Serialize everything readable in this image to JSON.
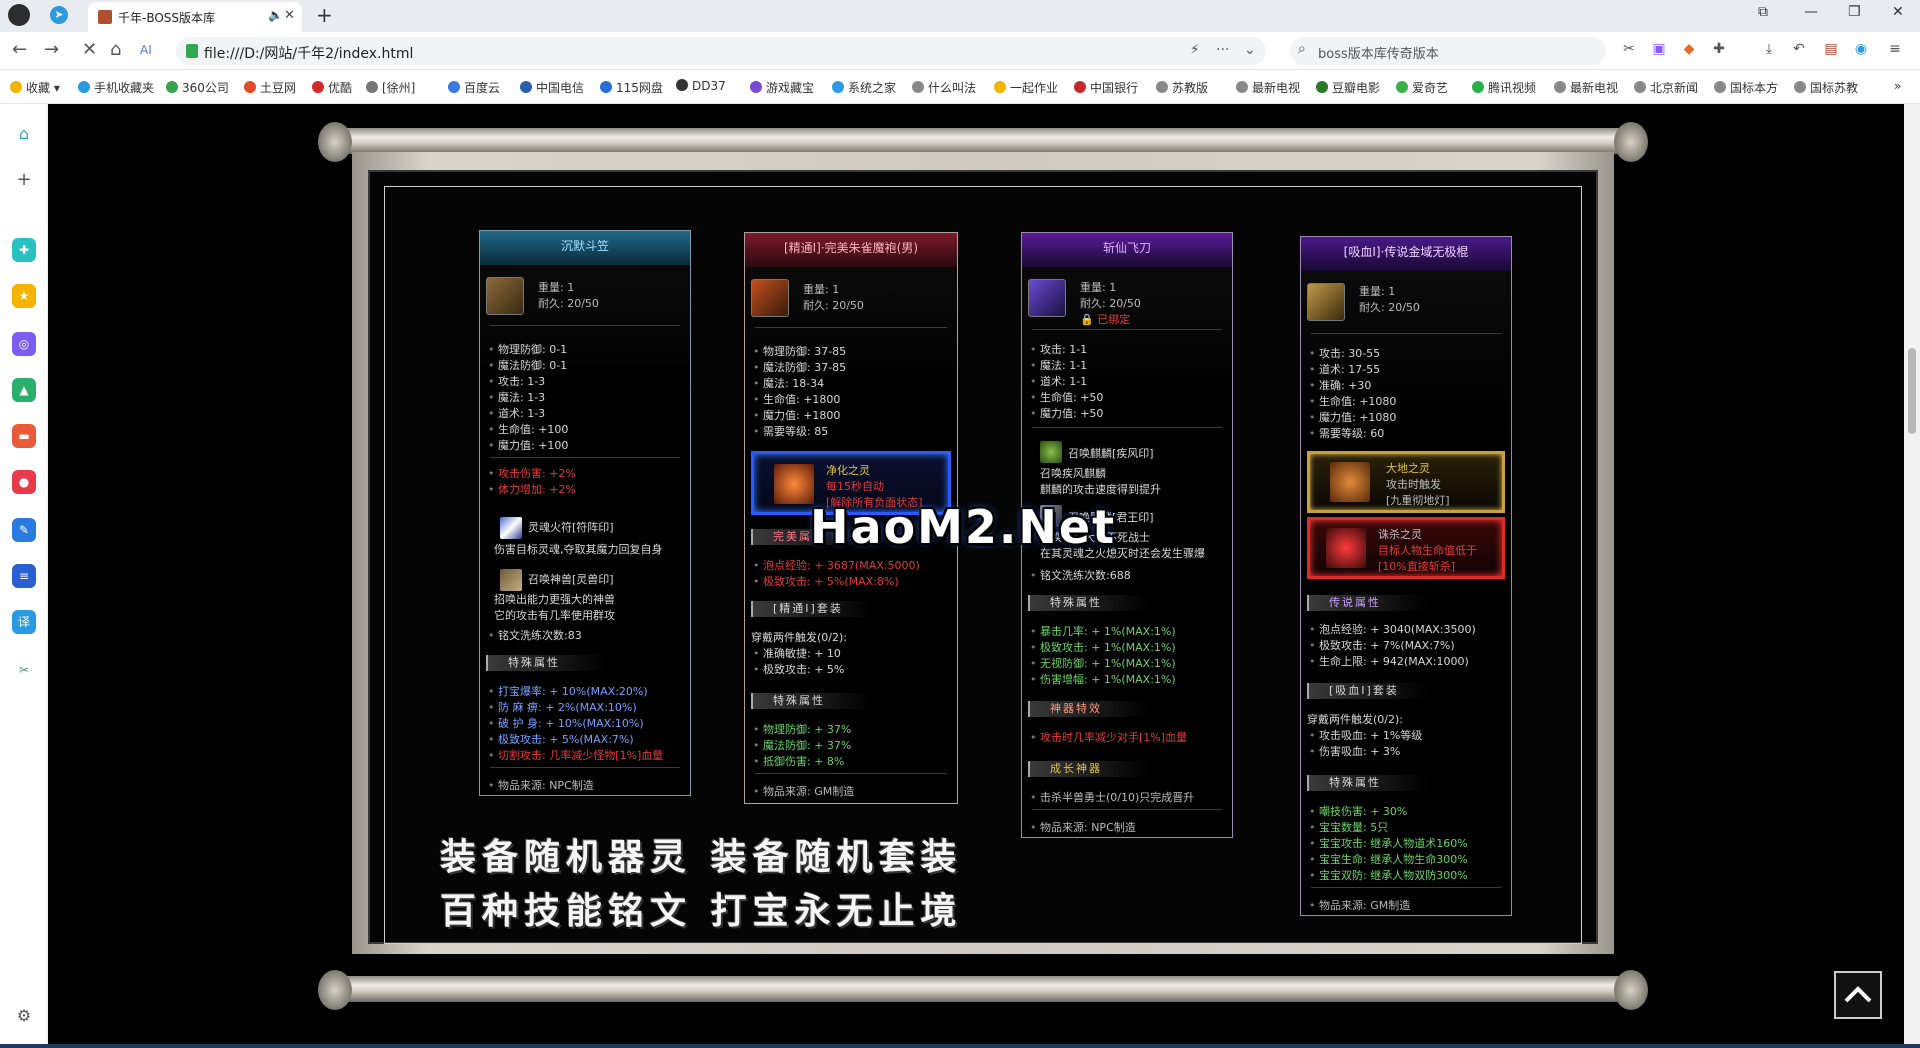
{
  "browser": {
    "tab_title": "千年-BOSS版本库",
    "new_tab": "+",
    "url": "file:///D:/网站/千年2/index.html",
    "search_text": "boss版本库传奇版本",
    "bookmarks": [
      "收藏",
      "手机收藏夹",
      "360公司",
      "土豆网",
      "优酷",
      "[徐州]",
      "百度云",
      "中国电信",
      "115网盘",
      "DD37",
      "游戏藏宝",
      "系统之家",
      "什么叫法",
      "一起作业",
      "中国银行",
      "苏教版",
      "最新电视",
      "豆瓣电影",
      "爱奇艺",
      "腾讯视频",
      "最新电视",
      "北京新闻",
      "国标本方",
      "国标苏教"
    ]
  },
  "cards": [
    {
      "title": "沉默斗笠",
      "weight": "重量: 1",
      "durability": "耐久: 20/50",
      "stats": [
        "物理防御: 0-1",
        "魔法防御: 0-1",
        "攻击: 1-3",
        "魔法: 1-3",
        "道术: 1-3",
        "生命值: +100",
        "魔力值: +100"
      ],
      "red_stats": [
        "攻击伤害: +2%",
        "体力增加: +2%"
      ],
      "skill1_name": "灵魂火符[符阵印]",
      "skill1_desc": "伤害目标灵魂,夺取其魔力回复自身",
      "skill2_name": "召唤神兽[灵兽印]",
      "skill2_desc1": "招唤出能力更强大的神兽",
      "skill2_desc2": "它的攻击有几率使用群攻",
      "refine": "铭文洗练次数:83",
      "section": "特殊属性",
      "special": [
        "打宝爆率: + 10%(MAX:20%)",
        "防 麻 痹: + 2%(MAX:10%)",
        "破 护 身: + 10%(MAX:10%)",
        "极致攻击: + 5%(MAX:7%)"
      ],
      "special_red": "切割攻击: 几率减少怪物[1%]血量",
      "source": "物品来源: NPC制造"
    },
    {
      "title": "[精通Ⅰ]·完美朱雀魔袍(男)",
      "weight": "重量: 1",
      "durability": "耐久: 20/50",
      "stats": [
        "物理防御: 37-85",
        "魔法防御: 37-85",
        "魔法: 18-34",
        "生命值: +1800",
        "魔力值: +1800",
        "需要等级: 85"
      ],
      "spirit_name": "净化之灵",
      "spirit_line1": "每15秒自动",
      "spirit_line2": "[解除所有负面状态]",
      "perfect_label": "完美属性",
      "perfect_stats": [
        "泡点经验: + 3687(MAX:5000)",
        "极致攻击: + 5%(MAX:8%)"
      ],
      "set_label": "[精通Ⅰ]套装",
      "set_trigger": "穿戴两件触发(0/2):",
      "set_stats": [
        "准确敏捷: + 10",
        "极致攻击: + 5%"
      ],
      "section": "特殊属性",
      "special": [
        "物理防御: + 37%",
        "魔法防御: + 37%",
        "抵御伤害: + 8%"
      ],
      "source": "物品来源: GM制造"
    },
    {
      "title": "斩仙飞刀",
      "weight": "重量: 1",
      "durability": "耐久: 20/50",
      "bound": "已绑定",
      "stats": [
        "攻击: 1-1",
        "魔法: 1-1",
        "道术: 1-1",
        "生命值: +50",
        "魔力值: +50"
      ],
      "skill1_name": "召唤麒麟[疾风印]",
      "skill1_desc1": "召唤疾风麒麟",
      "skill1_desc2": "麒麟的攻击速度得到提升",
      "skill2_name": "召唤骷髅[君王印]",
      "skill2_desc1": "召唤出强大的不死战士",
      "skill2_desc2": "在其灵魂之火熄灭时还会发生骤爆",
      "refine": "铭文洗练次数:688",
      "section": "特殊属性",
      "special": [
        "暴击几率: + 1%(MAX:1%)",
        "极致攻击: + 1%(MAX:1%)",
        "无视防御: + 1%(MAX:1%)",
        "伤害增幅: + 1%(MAX:1%)"
      ],
      "godeffect_label": "神器特效",
      "godeffect": "攻击时几率减少对手[1%]血量",
      "grow_label": "成长神器",
      "grow": "击杀半兽勇士(0/10)只完成晋升",
      "source": "物品来源: NPC制造"
    },
    {
      "title": "[吸血Ⅰ]·传说金域无极棍",
      "weight": "重量: 1",
      "durability": "耐久: 20/50",
      "stats": [
        "攻击: 30-55",
        "道术: 17-55",
        "准确: +30",
        "生命值: +1080",
        "魔力值: +1080",
        "需要等级: 60"
      ],
      "earth_name": "大地之灵",
      "earth_line1": "攻击时触发",
      "earth_line2": "[九重彻地灯]",
      "kill_name": "诛杀之灵",
      "kill_line1": "目标人物生命值低于",
      "kill_line2": "[10%直接斩杀]",
      "legend_label": "传说属性",
      "legend_stats": [
        "泡点经验: + 3040(MAX:3500)",
        "极致攻击: + 7%(MAX:7%)",
        "生命上限: + 942(MAX:1000)"
      ],
      "set_label": "[吸血Ⅰ]套装",
      "set_trigger": "穿戴两件触发(0/2):",
      "set_stats": [
        "攻击吸血: + 1%等级",
        "伤害吸血: + 3%"
      ],
      "section": "特殊属性",
      "special": [
        "嘲技伤害: + 30%",
        "宝宝数量: 5只",
        "宝宝攻击: 继承人物道术160%",
        "宝宝生命: 继承人物生命300%",
        "宝宝双防: 继承人物双防300%"
      ],
      "source": "物品来源: GM制造"
    }
  ],
  "slogan_line1": "装备随机器灵 装备随机套装",
  "slogan_line2": "百种技能铭文 打宝永无止境",
  "watermark": "HaoM2.Net",
  "colors": {
    "accent_blue": "#2a9be0",
    "card_border": "#c9c9c9",
    "red_text": "#e23b3b"
  }
}
